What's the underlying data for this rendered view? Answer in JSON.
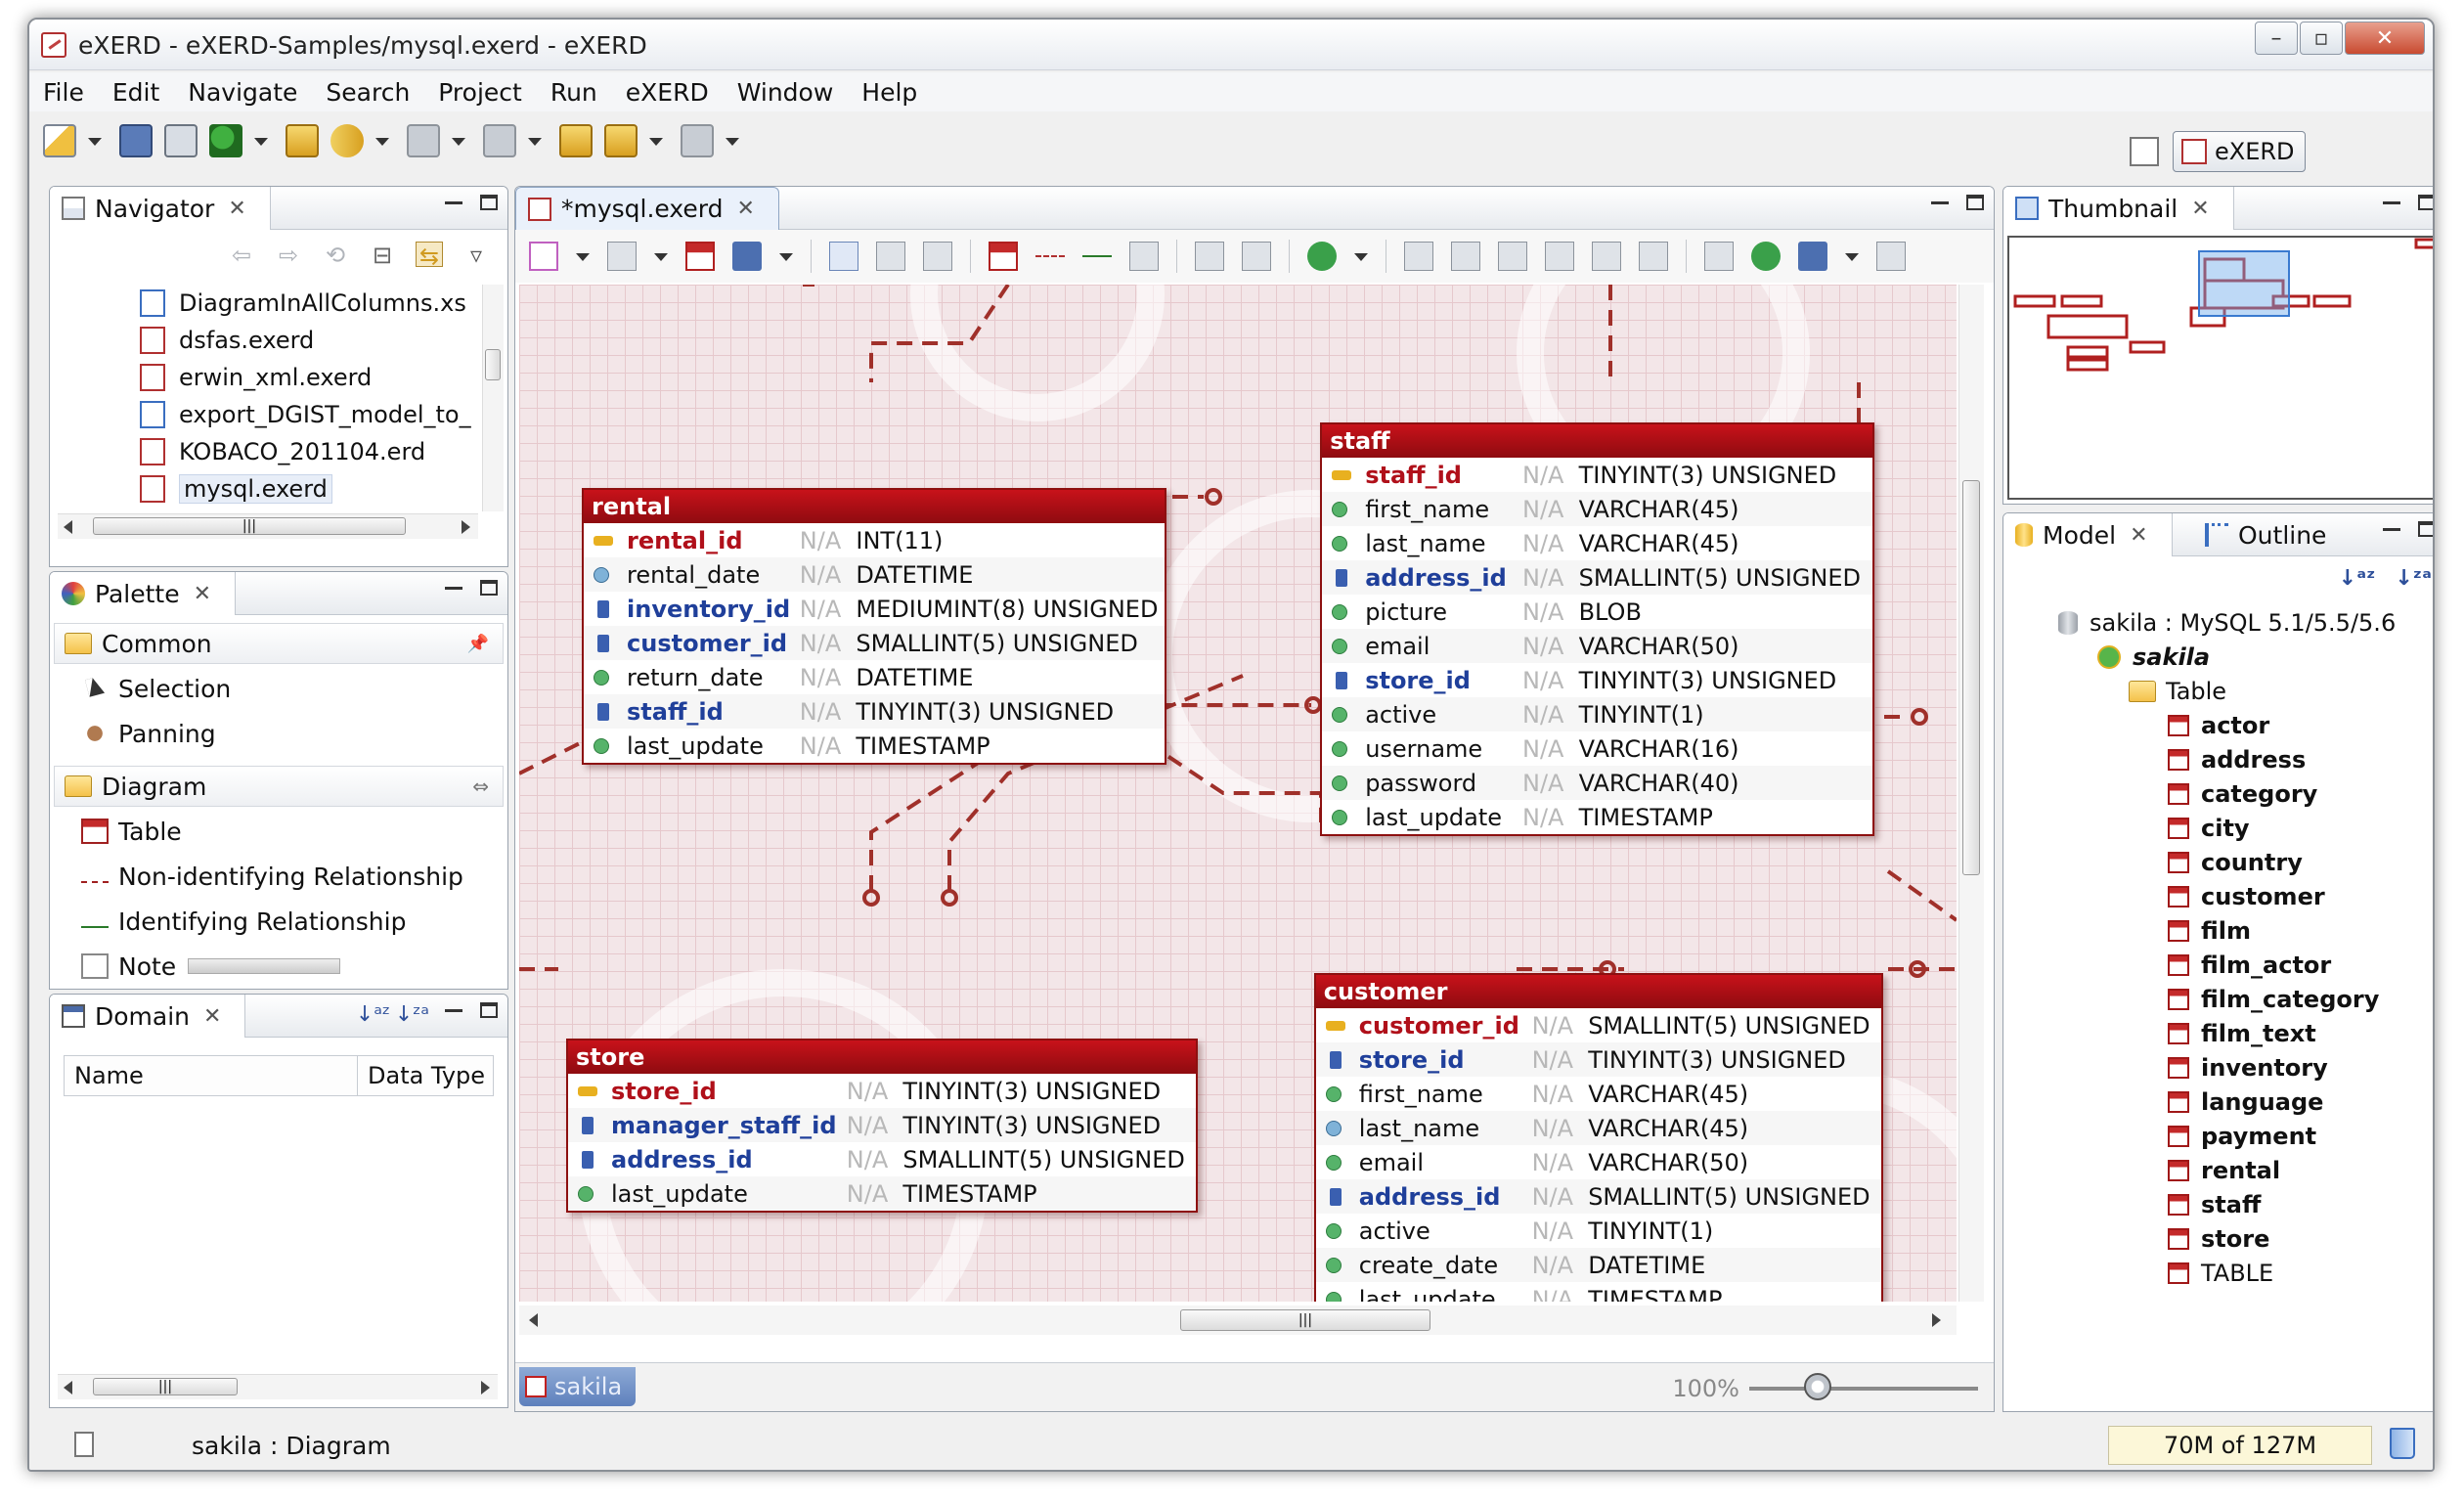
{
  "window": {
    "title": "eXERD - eXERD-Samples/mysql.exerd - eXERD"
  },
  "menu": [
    "File",
    "Edit",
    "Navigate",
    "Search",
    "Project",
    "Run",
    "eXERD",
    "Window",
    "Help"
  ],
  "perspective": {
    "label": "eXERD"
  },
  "navigator": {
    "title": "Navigator",
    "files": [
      {
        "name": "DiagramInAllColumns.xs",
        "icon": "file-icon"
      },
      {
        "name": "dsfas.exerd",
        "icon": "exerd-file-icon"
      },
      {
        "name": "erwin_xml.exerd",
        "icon": "exerd-file-icon"
      },
      {
        "name": "export_DGIST_model_to_",
        "icon": "file-icon"
      },
      {
        "name": "KOBACO_201104.erd",
        "icon": "exerd-file-icon"
      },
      {
        "name": "mysql.exerd",
        "icon": "exerd-file-icon",
        "selected": true
      }
    ]
  },
  "palette": {
    "title": "Palette",
    "groups": [
      {
        "label": "Common",
        "items": [
          "Selection",
          "Panning"
        ]
      },
      {
        "label": "Diagram",
        "items": [
          "Table",
          "Non-identifying Relationship",
          "Identifying Relationship",
          "Note"
        ]
      }
    ]
  },
  "domain": {
    "title": "Domain",
    "columns": [
      "Name",
      "Data Type"
    ]
  },
  "editor": {
    "tab": "*mysql.exerd",
    "sheet": "sakila",
    "zoom": "100%",
    "zoom_fraction": 0.3
  },
  "na": "N/A",
  "entities": {
    "rental": {
      "name": "rental",
      "rows": [
        {
          "name": "rental_id",
          "kind": "pk",
          "type": "INT(11)"
        },
        {
          "name": "rental_date",
          "kind": "ak",
          "type": "DATETIME"
        },
        {
          "name": "inventory_id",
          "kind": "fk",
          "type": "MEDIUMINT(8) UNSIGNED"
        },
        {
          "name": "customer_id",
          "kind": "fk",
          "type": "SMALLINT(5) UNSIGNED"
        },
        {
          "name": "return_date",
          "kind": "col",
          "type": "DATETIME"
        },
        {
          "name": "staff_id",
          "kind": "fk",
          "type": "TINYINT(3) UNSIGNED"
        },
        {
          "name": "last_update",
          "kind": "col",
          "type": "TIMESTAMP"
        }
      ]
    },
    "staff": {
      "name": "staff",
      "rows": [
        {
          "name": "staff_id",
          "kind": "pk",
          "type": "TINYINT(3) UNSIGNED"
        },
        {
          "name": "first_name",
          "kind": "col",
          "type": "VARCHAR(45)"
        },
        {
          "name": "last_name",
          "kind": "col",
          "type": "VARCHAR(45)"
        },
        {
          "name": "address_id",
          "kind": "fk",
          "type": "SMALLINT(5) UNSIGNED"
        },
        {
          "name": "picture",
          "kind": "col",
          "type": "BLOB"
        },
        {
          "name": "email",
          "kind": "col",
          "type": "VARCHAR(50)"
        },
        {
          "name": "store_id",
          "kind": "fk",
          "type": "TINYINT(3) UNSIGNED"
        },
        {
          "name": "active",
          "kind": "col",
          "type": "TINYINT(1)"
        },
        {
          "name": "username",
          "kind": "col",
          "type": "VARCHAR(16)"
        },
        {
          "name": "password",
          "kind": "col",
          "type": "VARCHAR(40)"
        },
        {
          "name": "last_update",
          "kind": "col",
          "type": "TIMESTAMP"
        }
      ]
    },
    "store": {
      "name": "store",
      "rows": [
        {
          "name": "store_id",
          "kind": "pk",
          "type": "TINYINT(3) UNSIGNED"
        },
        {
          "name": "manager_staff_id",
          "kind": "fk",
          "type": "TINYINT(3) UNSIGNED"
        },
        {
          "name": "address_id",
          "kind": "fk",
          "type": "SMALLINT(5) UNSIGNED"
        },
        {
          "name": "last_update",
          "kind": "col",
          "type": "TIMESTAMP"
        }
      ]
    },
    "customer": {
      "name": "customer",
      "rows": [
        {
          "name": "customer_id",
          "kind": "pk",
          "type": "SMALLINT(5) UNSIGNED"
        },
        {
          "name": "store_id",
          "kind": "fk",
          "type": "TINYINT(3) UNSIGNED"
        },
        {
          "name": "first_name",
          "kind": "col",
          "type": "VARCHAR(45)"
        },
        {
          "name": "last_name",
          "kind": "ak",
          "type": "VARCHAR(45)"
        },
        {
          "name": "email",
          "kind": "col",
          "type": "VARCHAR(50)"
        },
        {
          "name": "address_id",
          "kind": "fk",
          "type": "SMALLINT(5) UNSIGNED"
        },
        {
          "name": "active",
          "kind": "col",
          "type": "TINYINT(1)"
        },
        {
          "name": "create_date",
          "kind": "col",
          "type": "DATETIME"
        },
        {
          "name": "last_update",
          "kind": "col",
          "type": "TIMESTAMP"
        }
      ]
    }
  },
  "thumbnail": {
    "title": "Thumbnail"
  },
  "model": {
    "title": "Model",
    "outline_title": "Outline",
    "root": "sakila : MySQL 5.1/5.5/5.6",
    "schema": "sakila",
    "folder": "Table",
    "tables": [
      "actor",
      "address",
      "category",
      "city",
      "country",
      "customer",
      "film",
      "film_actor",
      "film_category",
      "film_text",
      "inventory",
      "language",
      "payment",
      "rental",
      "staff",
      "store"
    ],
    "new_table": "TABLE"
  },
  "status": {
    "text": "sakila : Diagram",
    "memory": "70M of 127M"
  },
  "colors": {
    "entity_header": "#b0101a",
    "relationship": "#a0302a",
    "canvas": "#f3e6e8"
  }
}
